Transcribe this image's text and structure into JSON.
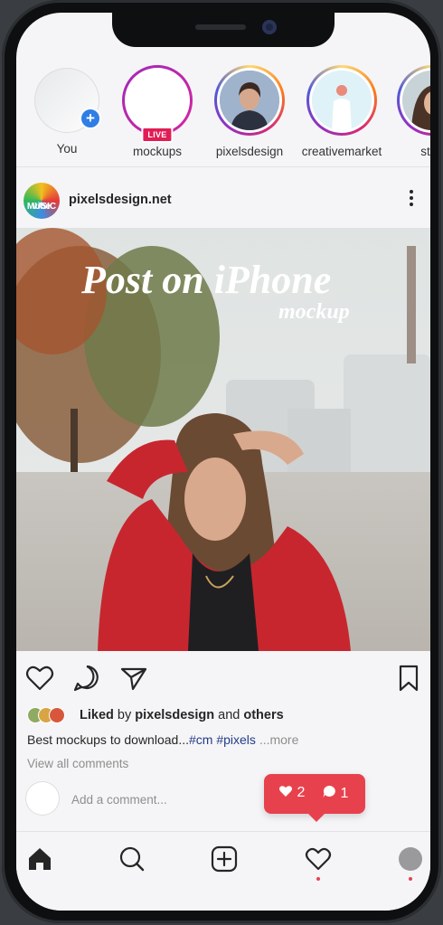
{
  "stories": [
    {
      "name": "You",
      "type": "own"
    },
    {
      "name": "mockups",
      "type": "live",
      "badge": "LIVE"
    },
    {
      "name": "pixelsdesign",
      "type": "photo"
    },
    {
      "name": "creativemarket",
      "type": "placeholder"
    },
    {
      "name": "stud",
      "type": "photo"
    }
  ],
  "post": {
    "username": "pixelsdesign.net",
    "avatar_text_1": "vibe",
    "avatar_text_2": "MUSIC",
    "image_title": "Post on iPhone",
    "image_subtitle": "mockup",
    "liked_prefix": "Liked",
    "liked_by": "by",
    "liked_user": "pixelsdesign",
    "liked_and": "and",
    "liked_others": "others",
    "caption": "Best mockups to download...",
    "hashtags": "#cm #pixels",
    "more": "...more",
    "view_comments": "View all comments",
    "comment_placeholder": "Add a comment..."
  },
  "notification": {
    "likes": "2",
    "comments": "1"
  },
  "colors": {
    "accent_red": "#e8414e",
    "hashtag": "#233b87",
    "live": "#e11d55"
  },
  "icons": [
    "home-icon",
    "search-icon",
    "add-post-icon",
    "activity-heart-icon",
    "profile-icon"
  ]
}
